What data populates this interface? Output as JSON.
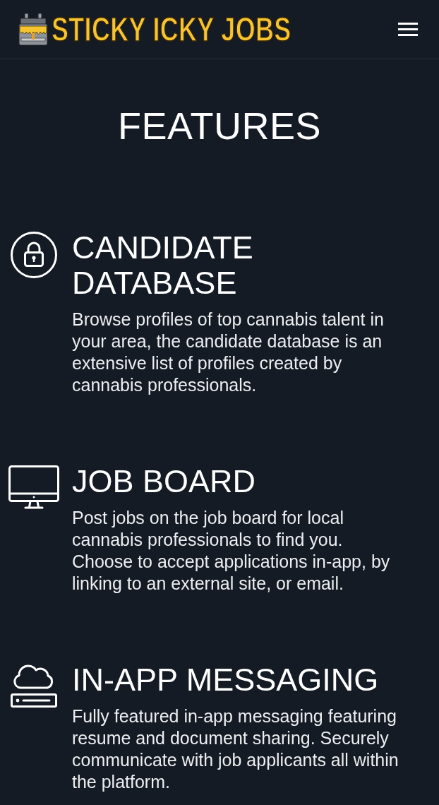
{
  "header": {
    "logo_text": "STICKY ICKY JOBS"
  },
  "title": "FEATURES",
  "features": [
    {
      "kind": "lock",
      "heading": "CANDIDATE DATABASE",
      "description": "Browse profiles of top cannabis talent in your area, the candidate database is an extensive list of profiles created by cannabis professionals."
    },
    {
      "kind": "monitor",
      "heading": "JOB BOARD",
      "description": "Post jobs on the job board for local cannabis professionals to find you. Choose to accept applications in-app, by linking to an external site, or email."
    },
    {
      "kind": "cloud-server",
      "heading": "IN-APP MESSAGING",
      "description": "Fully featured in-app messaging featuring resume and document sharing. Securely communicate with job applicants all within the platform."
    }
  ]
}
